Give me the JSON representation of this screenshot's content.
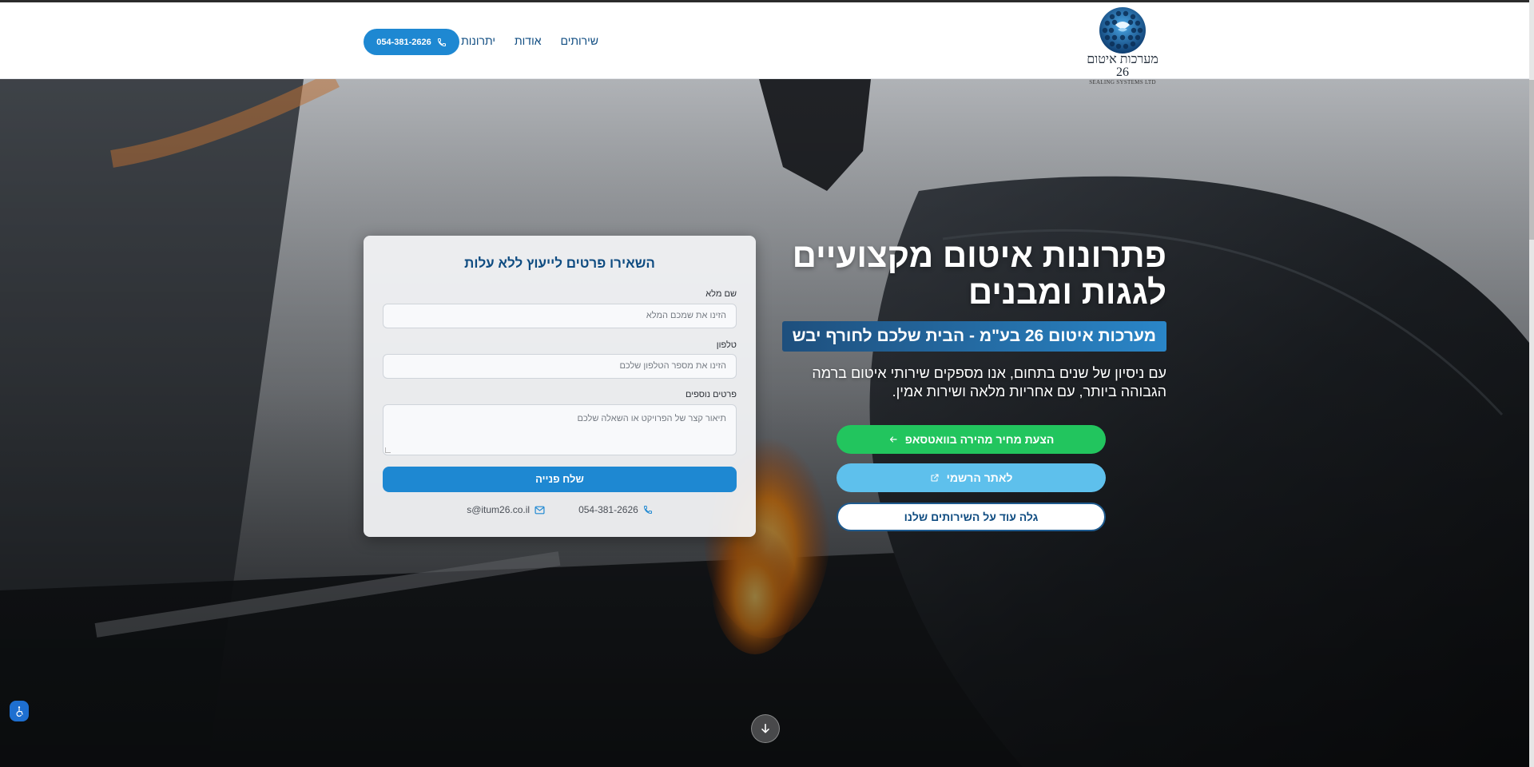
{
  "header": {
    "logo_he": "מערכות איטום 26",
    "logo_en": "SEALING SYSTEMS LTD",
    "nav": [
      "שירותים",
      "אודות",
      "יתרונות"
    ],
    "phone": "054-381-2626"
  },
  "hero": {
    "title": "פתרונות איטום מקצועיים לגגות ומבנים",
    "subtitle": "מערכות איטום 26 בע\"מ - הבית שלכם לחורף יבש",
    "description": "עם ניסיון של שנים בתחום, אנו מספקים שירותי איטום ברמה הגבוהה ביותר, עם אחריות מלאה ושירות אמין.",
    "cta_whatsapp": "הצעת מחיר מהירה בוואטסאפ",
    "cta_site": "לאתר הרשמי",
    "cta_services": "גלה עוד על השירותים שלנו"
  },
  "form": {
    "title": "השאירו פרטים לייעוץ ללא עלות",
    "name_label": "שם מלא",
    "name_placeholder": "הזינו את שמכם המלא",
    "phone_label": "טלפון",
    "phone_placeholder": "הזינו את מספר הטלפון שלכם",
    "details_label": "פרטים נוספים",
    "details_placeholder": "תיאור קצר של הפרויקט או השאלה שלכם",
    "submit": "שלח פנייה",
    "contact_phone": "054-381-2626",
    "contact_email": "s@itum26.co.il"
  },
  "colors": {
    "primary": "#1e88d2",
    "navy": "#0f4c81",
    "whatsapp": "#22c55e",
    "light_blue": "#5ec0ec"
  },
  "icons": {
    "phone": "phone-icon",
    "mail": "mail-icon",
    "arrow": "arrow-left-icon",
    "external": "external-link-icon",
    "scroll": "arrow-down-icon",
    "accessibility": "accessibility-icon"
  }
}
